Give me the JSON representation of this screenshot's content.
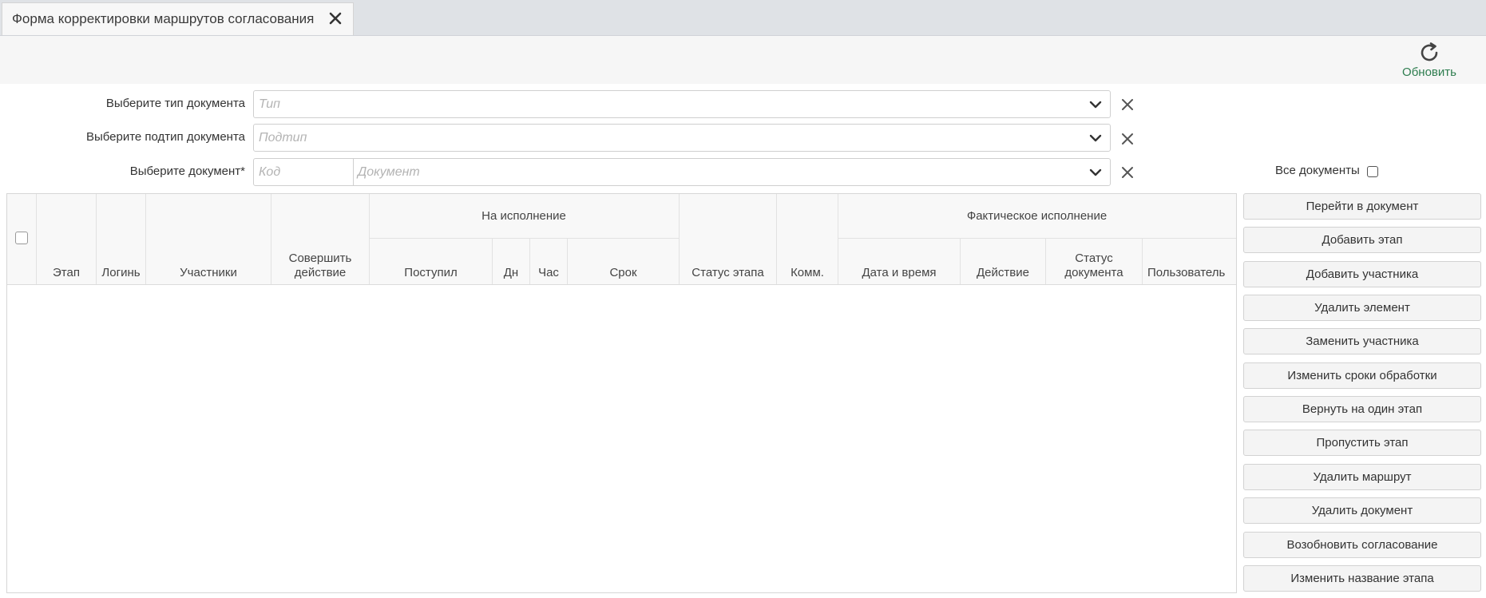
{
  "tab": {
    "title": "Форма корректировки маршрутов согласования"
  },
  "toolbar": {
    "refresh_label": "Обновить"
  },
  "filters": {
    "doc_type": {
      "label": "Выберите тип документа",
      "placeholder": "Тип"
    },
    "doc_subtype": {
      "label": "Выберите подтип документа",
      "placeholder": "Подтип"
    },
    "document": {
      "label": "Выберите документ*",
      "code_placeholder": "Код",
      "doc_placeholder": "Документ"
    },
    "all_docs_label": "Все документы"
  },
  "grid": {
    "groups": {
      "execution": "На исполнение",
      "actual": "Фактическое исполнение"
    },
    "columns": {
      "stage": "Этап",
      "login": "Логинь",
      "participants": "Участники",
      "action_l1": "Совершить",
      "action_l2": "действие",
      "received": "Поступил",
      "days": "Дн",
      "hours": "Час",
      "deadline": "Срок",
      "stage_status": "Статус этапа",
      "comment": "Комм.",
      "datetime": "Дата и время",
      "act": "Действие",
      "doc_status_l1": "Статус",
      "doc_status_l2": "документа",
      "user": "Пользователь"
    }
  },
  "actions": [
    "Перейти в документ",
    "Добавить этап",
    "Добавить участника",
    "Удалить элемент",
    "Заменить участника",
    "Изменить сроки обработки",
    "Вернуть на один этап",
    "Пропустить этап",
    "Удалить маршрут",
    "Удалить документ",
    "Возобновить согласование",
    "Изменить название этапа"
  ],
  "colors": {
    "accent_green": "#2e7d4f",
    "tab_bar": "#dfe2e6"
  }
}
